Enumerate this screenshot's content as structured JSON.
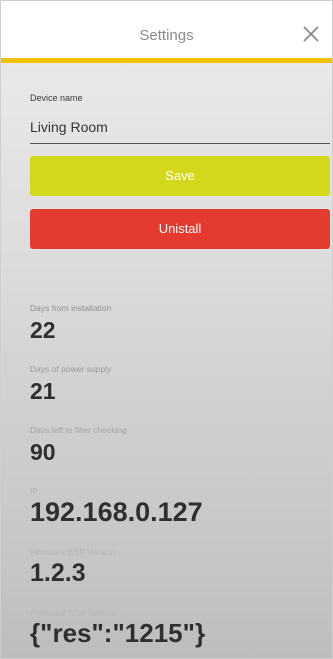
{
  "header": {
    "title": "Settings",
    "close_icon": "close-icon",
    "accent_color": "#f2c200"
  },
  "device_name": {
    "label": "Device name",
    "value": "Living Room"
  },
  "buttons": {
    "save_label": "Save",
    "save_color": "#d4d81a",
    "uninstall_label": "Unistall",
    "uninstall_color": "#e53a2f"
  },
  "stats": [
    {
      "label": "Days from installation",
      "value": "22"
    },
    {
      "label": "Days of power supply",
      "value": "21"
    },
    {
      "label": "Days left to filter checking",
      "value": "90"
    },
    {
      "label": "IP",
      "value": "192.168.0.127"
    },
    {
      "label": "Firmware ESP Version",
      "value": "1.2.3"
    },
    {
      "label": "Firmware STM Version",
      "value": "{\"res\":\"1215\"}"
    }
  ]
}
